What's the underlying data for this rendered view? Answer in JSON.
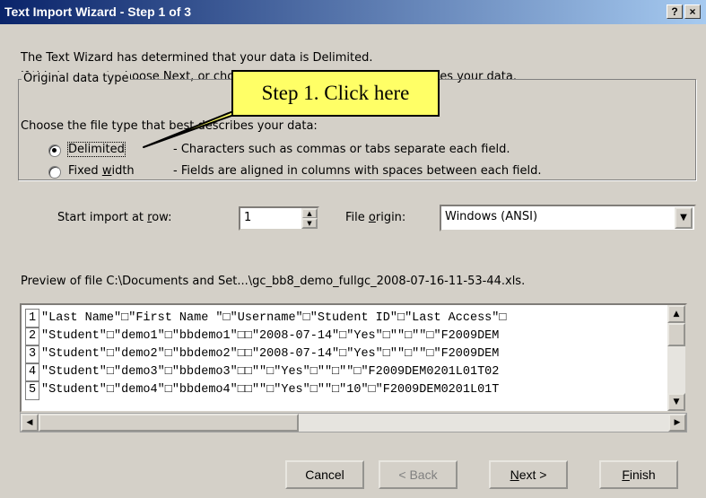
{
  "window": {
    "title": "Text Import Wizard - Step 1 of 3",
    "help_btn": "?",
    "close_btn": "×"
  },
  "intro": {
    "line1": "The Text Wizard has determined that your data is Delimited.",
    "line2": "If this is correct, choose Next, or choose the data type that best describes your data."
  },
  "group": {
    "legend": "Original data type",
    "prompt": "Choose the file type that best describes your data:",
    "delimited_label": "Delimited",
    "delimited_desc": "- Characters such as commas or tabs separate each field.",
    "fixed_label_pre": "Fixed ",
    "fixed_label_u": "w",
    "fixed_label_post": "idth",
    "fixed_desc": "- Fields are aligned in columns with spaces between each field.",
    "selected": "Delimited"
  },
  "import_row": {
    "label_pre": "Start import at ",
    "label_u": "r",
    "label_post": "ow:",
    "value": "1"
  },
  "file_origin": {
    "label_pre": "File ",
    "label_u": "o",
    "label_post": "rigin:",
    "value": "Windows (ANSI)"
  },
  "preview": {
    "label": "Preview of file C:\\Documents and Set...\\gc_bb8_demo_fullgc_2008-07-16-11-53-44.xls.",
    "rows": [
      {
        "n": "1",
        "text": "\"Last Name\"□\"First Name \"□\"Username\"□\"Student ID\"□\"Last Access\"□"
      },
      {
        "n": "2",
        "text": "\"Student\"□\"demo1\"□\"bbdemo1\"□□\"2008-07-14\"□\"Yes\"□\"\"□\"\"□\"F2009DEM"
      },
      {
        "n": "3",
        "text": "\"Student\"□\"demo2\"□\"bbdemo2\"□□\"2008-07-14\"□\"Yes\"□\"\"□\"\"□\"F2009DEM"
      },
      {
        "n": "4",
        "text": "\"Student\"□\"demo3\"□\"bbdemo3\"□□\"\"□\"Yes\"□\"\"□\"\"□\"F2009DEM0201L01T02"
      },
      {
        "n": "5",
        "text": "\"Student\"□\"demo4\"□\"bbdemo4\"□□\"\"□\"Yes\"□\"\"□\"10\"□\"F2009DEM0201L01T"
      }
    ]
  },
  "buttons": {
    "cancel": "Cancel",
    "back": "< Back",
    "next_u": "N",
    "next_rest": "ext >",
    "finish_u": "F",
    "finish_rest": "inish"
  },
  "callout": {
    "text": "Step 1. Click here"
  },
  "colors": {
    "face": "#d4d0c8",
    "title_start": "#0a246a",
    "title_end": "#a6caf0",
    "callout_bg": "#ffff66",
    "disabled_text": "#808080"
  }
}
